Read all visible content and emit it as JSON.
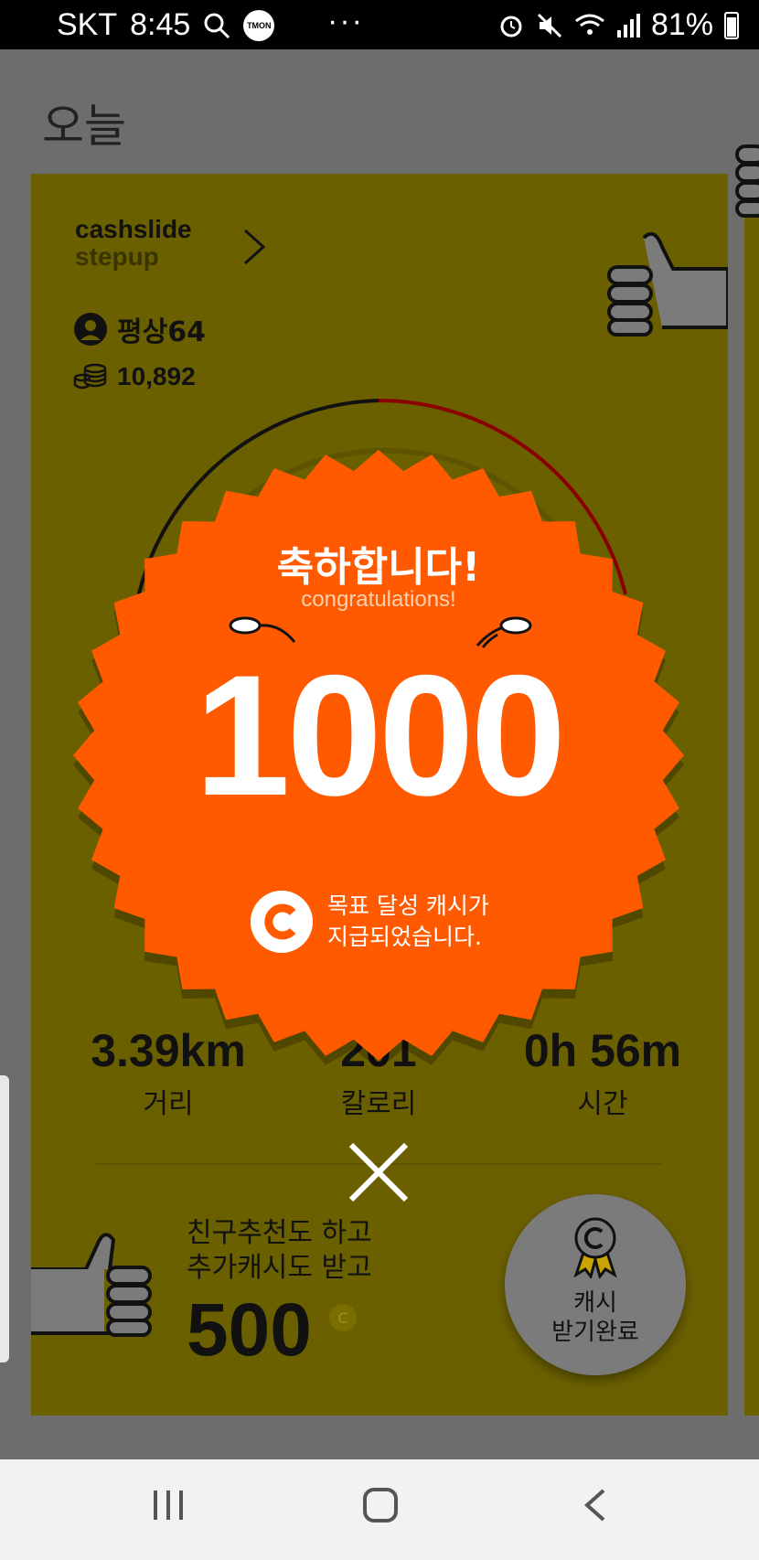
{
  "status_bar": {
    "carrier": "SKT",
    "time": "8:45",
    "tmon_badge": "TMON",
    "more": "···",
    "battery": "81%"
  },
  "page": {
    "title": "오늘"
  },
  "card": {
    "brand_line1": "cashslide",
    "brand_line2": "stepup",
    "username": "평상64",
    "coins": "10,892",
    "stats": [
      {
        "value": "3.39km",
        "label": "거리"
      },
      {
        "value": "201",
        "label": "칼로리"
      },
      {
        "value": "0h 56m",
        "label": "시간"
      }
    ],
    "invite_line1": "친구추천도 하고",
    "invite_line2": "추가캐시도 받고",
    "invite_amount": "500",
    "invite_coin_symbol": "C",
    "complete_line1": "캐시",
    "complete_line2": "받기완료"
  },
  "congrats": {
    "title": "축하합니다!",
    "subtitle": "congratulations!",
    "amount": "1000",
    "message_line1": "목표 달성 캐시가",
    "message_line2": "지급되었습니다."
  },
  "colors": {
    "badge": "#ff5a00",
    "card": "#6b6000",
    "overlay": "#6d6d6d"
  }
}
